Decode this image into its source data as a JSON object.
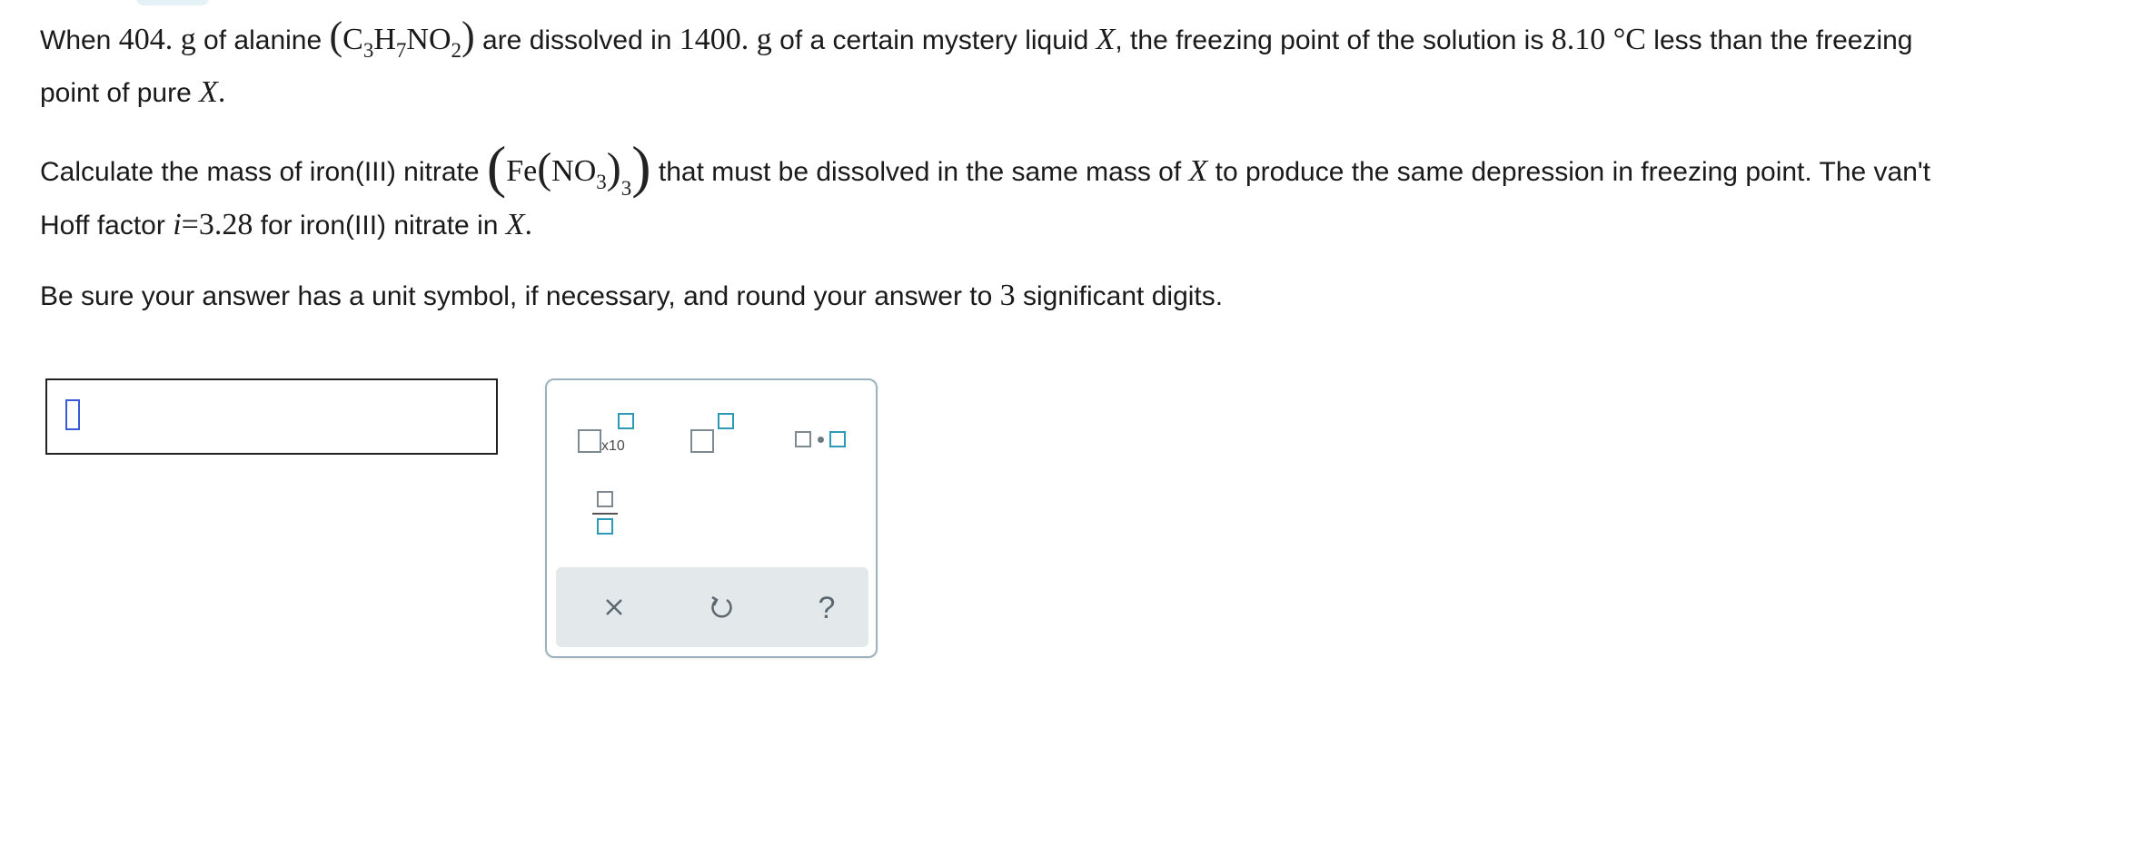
{
  "question": {
    "p1": {
      "t1": "When ",
      "mass1": "404. g",
      "t2": " of alanine ",
      "alanine": {
        "c": "C",
        "c_n": "3",
        "h": "H",
        "h_n": "7",
        "no": "NO",
        "no_n": "2"
      },
      "t3": " are dissolved in ",
      "mass2": "1400. g",
      "t4": " of a certain mystery liquid ",
      "liquid": "X",
      "t5": ", the freezing point of the solution is ",
      "delta": "8.10 °C",
      "t6": " less than the freezing",
      "line2a": "point of pure ",
      "line2b": "X",
      "line2c": "."
    },
    "p2": {
      "t1": "Calculate the mass of iron(III) nitrate ",
      "nitrate": {
        "fe": "Fe",
        "no": "NO",
        "n1": "3",
        "n2": "3"
      },
      "t2": " that must be dissolved in the same mass of ",
      "liquid": "X",
      "t3": " to produce the same depression in freezing point. The van't",
      "line2a": "Hoff factor ",
      "i_sym": "i",
      "i_eq": "=3.28",
      "line2b": " for iron(III) nitrate in ",
      "line2c": "X",
      "line2d": "."
    },
    "p3": {
      "t1": "Be sure your answer has a unit symbol, if necessary, and round your answer to ",
      "digits": "3",
      "t2": " significant digits."
    }
  },
  "palette": {
    "x10_label": "x10",
    "icons": [
      "times-ten-icon",
      "superscript-icon",
      "multiply-dot-icon",
      "fraction-icon"
    ],
    "actions": [
      "clear-icon",
      "undo-icon",
      "help-icon"
    ],
    "colors": {
      "accent": "#2b9bb5",
      "gray": "#7d8a91",
      "bar": "#e3e8ea",
      "cursor": "#3a5bd9"
    }
  }
}
